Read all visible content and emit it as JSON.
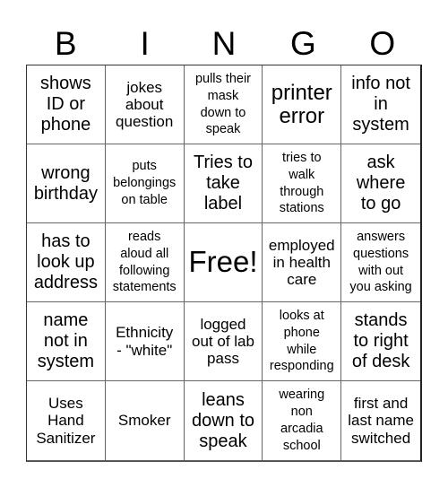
{
  "header": {
    "letters": [
      "B",
      "I",
      "N",
      "G",
      "O"
    ]
  },
  "card": {
    "rows": [
      [
        {
          "text": "shows\nID or\nphone",
          "size": "m"
        },
        {
          "text": "jokes\nabout\nquestion",
          "size": "s"
        },
        {
          "text": "pulls their\nmask\ndown to\nspeak",
          "size": "xs"
        },
        {
          "text": "printer\nerror",
          "size": "l"
        },
        {
          "text": "info not\nin\nsystem",
          "size": "m"
        }
      ],
      [
        {
          "text": "wrong\nbirthday",
          "size": "m"
        },
        {
          "text": "puts\nbelongings\non table",
          "size": "xs"
        },
        {
          "text": "Tries to\ntake\nlabel",
          "size": "m"
        },
        {
          "text": "tries to\nwalk\nthrough\nstations",
          "size": "xs"
        },
        {
          "text": "ask\nwhere\nto go",
          "size": "m"
        }
      ],
      [
        {
          "text": "has to\nlook up\naddress",
          "size": "m"
        },
        {
          "text": "reads\naloud all\nfollowing\nstatements",
          "size": "xs"
        },
        {
          "text": "Free!",
          "size": "xl"
        },
        {
          "text": "employed\nin health\ncare",
          "size": "s"
        },
        {
          "text": "answers\nquestions\nwith out\nyou asking",
          "size": "xs"
        }
      ],
      [
        {
          "text": "name\nnot in\nsystem",
          "size": "m"
        },
        {
          "text": "Ethnicity\n- \"white\"",
          "size": "s"
        },
        {
          "text": "logged\nout of lab\npass",
          "size": "s"
        },
        {
          "text": "looks at\nphone\nwhile\nresponding",
          "size": "xs"
        },
        {
          "text": "stands\nto right\nof desk",
          "size": "m"
        }
      ],
      [
        {
          "text": "Uses\nHand\nSanitizer",
          "size": "s"
        },
        {
          "text": "Smoker",
          "size": "s"
        },
        {
          "text": "leans\ndown to\nspeak",
          "size": "m"
        },
        {
          "text": "wearing\nnon\narcadia\nschool",
          "size": "xs"
        },
        {
          "text": "first and\nlast name\nswitched",
          "size": "s"
        }
      ]
    ]
  }
}
